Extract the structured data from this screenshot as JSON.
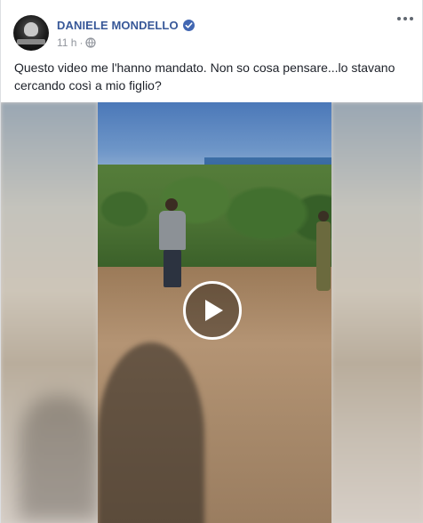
{
  "post": {
    "author_name": "DANIELE MONDELLO",
    "verified_icon": "verified-badge-icon",
    "timestamp": "11 h",
    "separator": "·",
    "audience_icon": "globe-icon",
    "more_icon": "more-options-icon",
    "text": "Questo video me l'hanno mandato. Non so cosa pensare...lo stavano cercando così a mio figlio?"
  },
  "video": {
    "play_icon": "play-icon"
  },
  "colors": {
    "author_name": "#385898",
    "verified_badge": "#4267b2",
    "meta_text": "#90949c",
    "post_text": "#1d2129"
  }
}
